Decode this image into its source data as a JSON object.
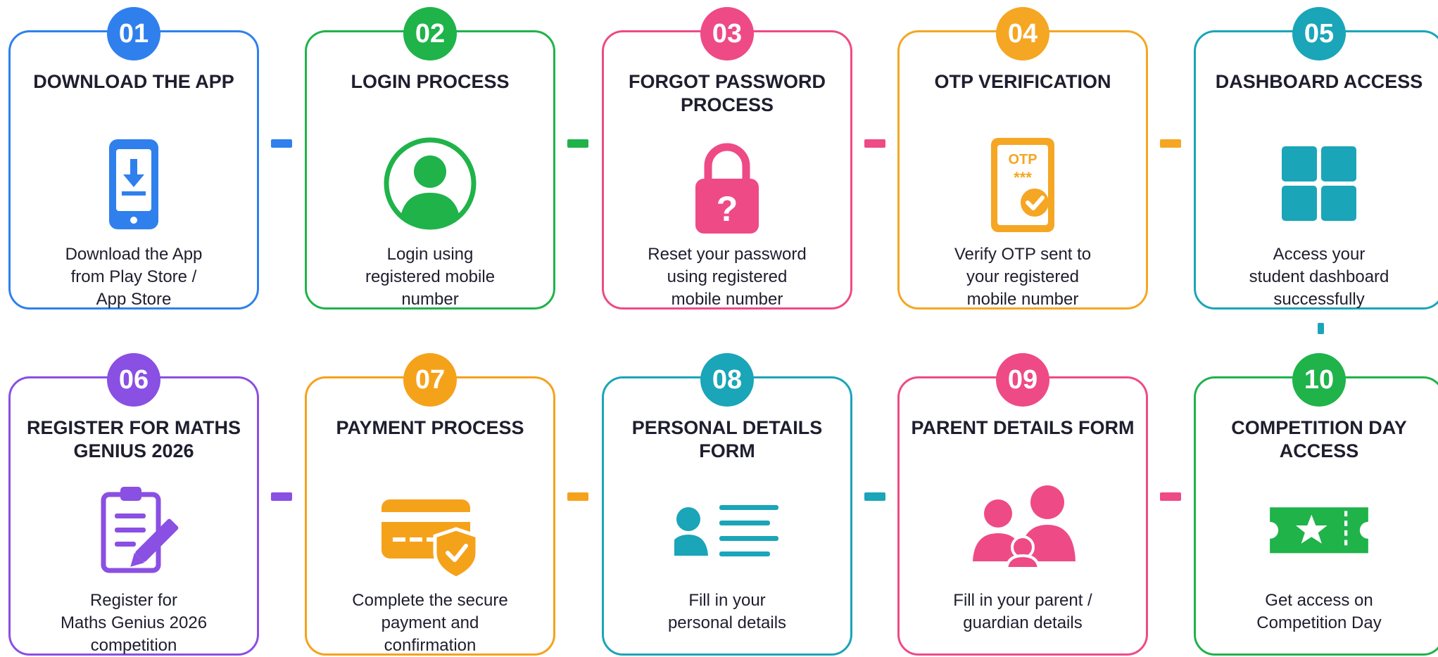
{
  "steps": [
    {
      "number": "01",
      "title": "DOWNLOAD THE APP",
      "desc": [
        "Download the App",
        "from Play Store /",
        "App Store"
      ],
      "icon": "phone-download-icon",
      "color": "#2f80ed"
    },
    {
      "number": "02",
      "title": "LOGIN PROCESS",
      "desc": [
        "Login using",
        "registered mobile",
        "number"
      ],
      "icon": "user-login-icon",
      "color": "#1fb34a"
    },
    {
      "number": "03",
      "title": "FORGOT PASSWORD PROCESS",
      "desc": [
        "Reset your password",
        "using registered",
        "mobile number"
      ],
      "icon": "padlock-question-icon",
      "color": "#ee4a86"
    },
    {
      "number": "04",
      "title": "OTP VERIFICATION",
      "desc": [
        "Verify OTP sent to",
        "your registered",
        "mobile number"
      ],
      "icon": "otp-phone-icon",
      "color": "#f5a623",
      "icon_text": "OTP",
      "icon_stars": "***"
    },
    {
      "number": "05",
      "title": "DASHBOARD ACCESS",
      "desc": [
        "Access your",
        "student dashboard",
        "successfully"
      ],
      "icon": "dashboard-grid-icon",
      "color": "#1aa5b8"
    },
    {
      "number": "06",
      "title": "REGISTER FOR MATHS GENIUS 2026",
      "desc": [
        "Register for",
        "Maths Genius 2026",
        "competition"
      ],
      "icon": "clipboard-pencil-icon",
      "color": "#8a4fe3"
    },
    {
      "number": "07",
      "title": "PAYMENT PROCESS",
      "desc": [
        "Complete the secure",
        "payment and",
        "confirmation"
      ],
      "icon": "card-shield-icon",
      "color": "#f5a21b"
    },
    {
      "number": "08",
      "title": "PERSONAL DETAILS FORM",
      "desc": [
        "Fill in your",
        "personal details",
        ""
      ],
      "icon": "profile-form-icon",
      "color": "#1aa5b8"
    },
    {
      "number": "09",
      "title": "PARENT DETAILS FORM",
      "desc": [
        "Fill in your parent /",
        "guardian details",
        ""
      ],
      "icon": "parent-child-icon",
      "color": "#ee4a86"
    },
    {
      "number": "10",
      "title": "COMPETITION DAY ACCESS",
      "desc": [
        "Get access on",
        "Competition Day",
        ""
      ],
      "icon": "ticket-star-icon",
      "color": "#1fb34a"
    }
  ]
}
